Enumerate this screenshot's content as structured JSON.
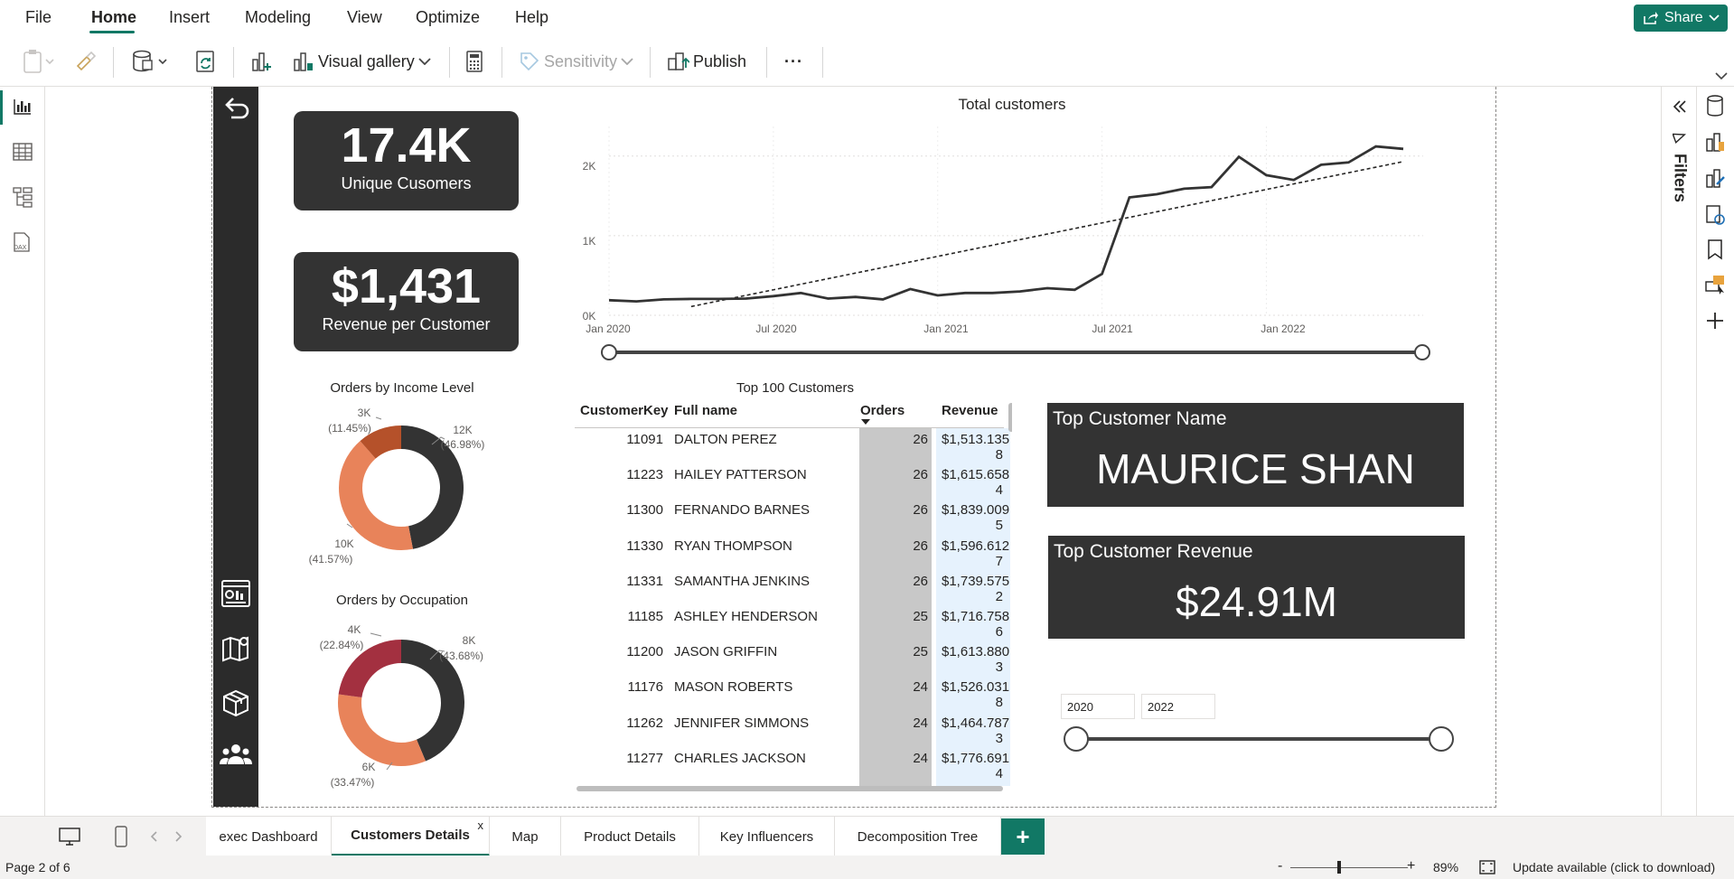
{
  "menu": {
    "items": [
      "File",
      "Home",
      "Insert",
      "Modeling",
      "View",
      "Optimize",
      "Help"
    ],
    "share_label": "Share"
  },
  "ribbon": {
    "visual_gallery_label": "Visual gallery",
    "sensitivity_label": "Sensitivity",
    "publish_label": "Publish",
    "more_label": "···"
  },
  "kpis": {
    "unique_customers_value": "17.4K",
    "unique_customers_label": "Unique Cusomers",
    "revenue_per_customer_value": "$1,431",
    "revenue_per_customer_label": "Revenue per Customer"
  },
  "line_chart": {
    "title": "Total customers",
    "y_ticks": [
      "2K",
      "1K",
      "0K"
    ],
    "x_ticks": [
      "Jan 2020",
      "Jul 2020",
      "Jan 2021",
      "Jul 2021",
      "Jan 2022"
    ]
  },
  "chart_data": [
    {
      "type": "line",
      "title": "Total customers",
      "x": [
        "2020-01",
        "2020-02",
        "2020-03",
        "2020-04",
        "2020-05",
        "2020-06",
        "2020-07",
        "2020-08",
        "2020-09",
        "2020-10",
        "2020-11",
        "2020-12",
        "2021-01",
        "2021-02",
        "2021-03",
        "2021-04",
        "2021-05",
        "2021-06",
        "2021-07",
        "2021-08",
        "2021-09",
        "2021-10",
        "2021-11",
        "2021-12",
        "2022-01",
        "2022-02",
        "2022-03",
        "2022-04",
        "2022-05",
        "2022-06"
      ],
      "series": [
        {
          "values": [
            190,
            175,
            200,
            205,
            205,
            210,
            240,
            280,
            210,
            230,
            200,
            330,
            250,
            280,
            280,
            300,
            340,
            320,
            520,
            1480,
            1520,
            1590,
            1610,
            1990,
            1760,
            1700,
            1890,
            1920,
            2120,
            2090
          ]
        },
        {
          "values": [
            -100,
            -30,
            40,
            110,
            180,
            250,
            320,
            390,
            460,
            530,
            600,
            670,
            740,
            810,
            880,
            950,
            1020,
            1090,
            1160,
            1230,
            1300,
            1370,
            1440,
            1510,
            1580,
            1650,
            1720,
            1790,
            1860,
            1930
          ]
        }
      ],
      "ylim": [
        0,
        2300
      ],
      "grid": true
    },
    {
      "type": "pie",
      "title": "Orders by Income Level",
      "labels": [
        "12K (46.98%)",
        "10K (41.57%)",
        "3K (11.45%)"
      ],
      "values": [
        46.98,
        41.57,
        11.45
      ],
      "colors": [
        "#333333",
        "#E8835A",
        "#B5512A"
      ]
    },
    {
      "type": "pie",
      "title": "Orders by Occupation",
      "labels": [
        "8K (43.68%)",
        "6K (33.47%)",
        "4K (22.84%)"
      ],
      "values": [
        43.68,
        33.47,
        22.84
      ],
      "colors": [
        "#333333",
        "#E8835A",
        "#A33040"
      ]
    }
  ],
  "donut1_labels": {
    "a_val": "12K",
    "a_pct": "(46.98%)",
    "b_val": "10K",
    "b_pct": "(41.57%)",
    "c_val": "3K",
    "c_pct": "(11.45%)"
  },
  "donut2_labels": {
    "a_val": "8K",
    "a_pct": "(43.68%)",
    "b_val": "6K",
    "b_pct": "(33.47%)",
    "c_val": "4K",
    "c_pct": "(22.84%)"
  },
  "table": {
    "title": "Top 100 Customers",
    "headers": [
      "CustomerKey",
      "Full name",
      "Orders",
      "Revenue"
    ],
    "rows": [
      {
        "key": "11091",
        "name": "DALTON PEREZ",
        "orders": "26",
        "rev1": "$1,513.135",
        "rev2": "8"
      },
      {
        "key": "11223",
        "name": "HAILEY PATTERSON",
        "orders": "26",
        "rev1": "$1,615.658",
        "rev2": "4"
      },
      {
        "key": "11300",
        "name": "FERNANDO BARNES",
        "orders": "26",
        "rev1": "$1,839.009",
        "rev2": "5"
      },
      {
        "key": "11330",
        "name": "RYAN THOMPSON",
        "orders": "26",
        "rev1": "$1,596.612",
        "rev2": "7"
      },
      {
        "key": "11331",
        "name": "SAMANTHA JENKINS",
        "orders": "26",
        "rev1": "$1,739.575",
        "rev2": "2"
      },
      {
        "key": "11185",
        "name": "ASHLEY HENDERSON",
        "orders": "25",
        "rev1": "$1,716.758",
        "rev2": "6"
      },
      {
        "key": "11200",
        "name": "JASON GRIFFIN",
        "orders": "25",
        "rev1": "$1,613.880",
        "rev2": "3"
      },
      {
        "key": "11176",
        "name": "MASON ROBERTS",
        "orders": "24",
        "rev1": "$1,526.031",
        "rev2": "8"
      },
      {
        "key": "11262",
        "name": "JENNIFER SIMMONS",
        "orders": "24",
        "rev1": "$1,464.787",
        "rev2": "3"
      },
      {
        "key": "11277",
        "name": "CHARLES JACKSON",
        "orders": "24",
        "rev1": "$1,776.691",
        "rev2": "4"
      }
    ]
  },
  "cards": {
    "top_name_title": "Top Customer Name",
    "top_name_value": "MAURICE SHAN",
    "top_rev_title": "Top Customer Revenue",
    "top_rev_value": "$24.91M"
  },
  "slicer": {
    "from": "2020",
    "to": "2022"
  },
  "filters_label": "Filters",
  "tabs": [
    "exec Dashboard",
    "Customers Details",
    "Map",
    "Product Details",
    "Key Influencers",
    "Decomposition Tree"
  ],
  "tab_close": "x",
  "add_tab": "+",
  "status": {
    "page": "Page 2 of 6",
    "zoom": "89%",
    "zoom_minus": "-",
    "zoom_plus": "+",
    "update": "Update available (click to download)"
  },
  "colors": {
    "accent": "#117865",
    "card": "#333333"
  }
}
